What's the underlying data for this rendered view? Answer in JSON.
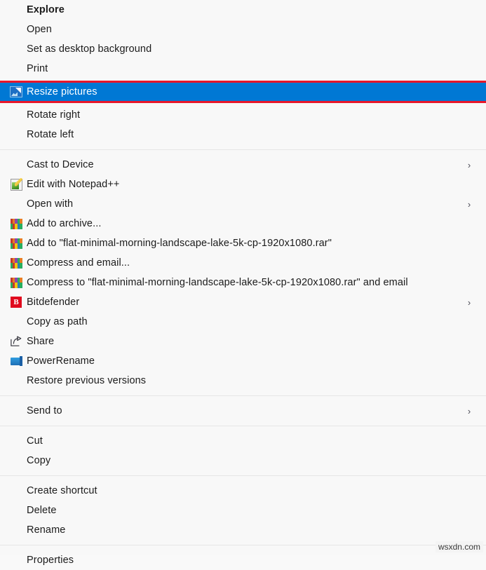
{
  "menu": {
    "background_color": "#f8f8f8",
    "highlight_color": "#0078d4",
    "annotation_color": "#e8172a",
    "groups": [
      {
        "items": [
          {
            "label": "Explore",
            "icon": "none",
            "bold": true,
            "submenu": false,
            "selected": false
          },
          {
            "label": "Open",
            "icon": "none",
            "bold": false,
            "submenu": false,
            "selected": false
          },
          {
            "label": "Set as desktop background",
            "icon": "none",
            "bold": false,
            "submenu": false,
            "selected": false
          },
          {
            "label": "Print",
            "icon": "none",
            "bold": false,
            "submenu": false,
            "selected": false
          },
          {
            "label": "Resize pictures",
            "icon": "resize-pictures-icon",
            "bold": false,
            "submenu": false,
            "selected": true
          },
          {
            "label": "Rotate right",
            "icon": "none",
            "bold": false,
            "submenu": false,
            "selected": false
          },
          {
            "label": "Rotate left",
            "icon": "none",
            "bold": false,
            "submenu": false,
            "selected": false
          }
        ]
      },
      {
        "items": [
          {
            "label": "Cast to Device",
            "icon": "none",
            "bold": false,
            "submenu": true,
            "selected": false
          },
          {
            "label": "Edit with Notepad++",
            "icon": "notepad-plus-plus-icon",
            "bold": false,
            "submenu": false,
            "selected": false
          },
          {
            "label": "Open with",
            "icon": "none",
            "bold": false,
            "submenu": true,
            "selected": false
          },
          {
            "label": "Add to archive...",
            "icon": "winrar-icon",
            "bold": false,
            "submenu": false,
            "selected": false
          },
          {
            "label": "Add to \"flat-minimal-morning-landscape-lake-5k-cp-1920x1080.rar\"",
            "icon": "winrar-icon",
            "bold": false,
            "submenu": false,
            "selected": false
          },
          {
            "label": "Compress and email...",
            "icon": "winrar-icon",
            "bold": false,
            "submenu": false,
            "selected": false
          },
          {
            "label": "Compress to \"flat-minimal-morning-landscape-lake-5k-cp-1920x1080.rar\" and email",
            "icon": "winrar-icon",
            "bold": false,
            "submenu": false,
            "selected": false
          },
          {
            "label": "Bitdefender",
            "icon": "bitdefender-icon",
            "bold": false,
            "submenu": true,
            "selected": false
          },
          {
            "label": "Copy as path",
            "icon": "none",
            "bold": false,
            "submenu": false,
            "selected": false
          },
          {
            "label": "Share",
            "icon": "share-icon",
            "bold": false,
            "submenu": false,
            "selected": false
          },
          {
            "label": "PowerRename",
            "icon": "powerrename-icon",
            "bold": false,
            "submenu": false,
            "selected": false
          },
          {
            "label": "Restore previous versions",
            "icon": "none",
            "bold": false,
            "submenu": false,
            "selected": false
          }
        ]
      },
      {
        "items": [
          {
            "label": "Send to",
            "icon": "none",
            "bold": false,
            "submenu": true,
            "selected": false
          }
        ]
      },
      {
        "items": [
          {
            "label": "Cut",
            "icon": "none",
            "bold": false,
            "submenu": false,
            "selected": false
          },
          {
            "label": "Copy",
            "icon": "none",
            "bold": false,
            "submenu": false,
            "selected": false
          }
        ]
      },
      {
        "items": [
          {
            "label": "Create shortcut",
            "icon": "none",
            "bold": false,
            "submenu": false,
            "selected": false
          },
          {
            "label": "Delete",
            "icon": "none",
            "bold": false,
            "submenu": false,
            "selected": false
          },
          {
            "label": "Rename",
            "icon": "none",
            "bold": false,
            "submenu": false,
            "selected": false
          }
        ]
      },
      {
        "items": [
          {
            "label": "Properties",
            "icon": "none",
            "bold": false,
            "submenu": false,
            "selected": false
          }
        ]
      }
    ]
  },
  "watermark": {
    "text": "wsxdn.com"
  },
  "glyphs": {
    "submenu_chevron": "›"
  }
}
